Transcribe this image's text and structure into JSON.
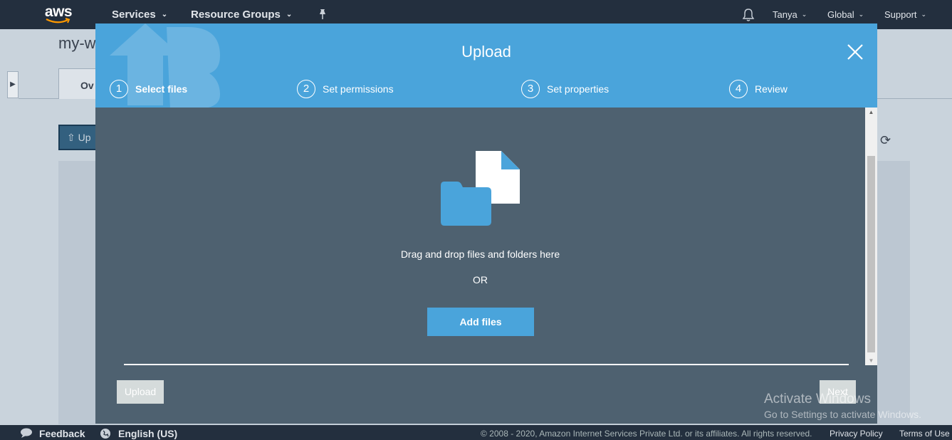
{
  "nav": {
    "logo": "aws",
    "services": "Services",
    "resource_groups": "Resource Groups",
    "pin_icon": "pin-icon",
    "bell_icon": "bell-icon",
    "user": "Tanya",
    "region": "Global",
    "support": "Support"
  },
  "background": {
    "bucket_title": "my-w",
    "tab_overview": "Ov",
    "upload_button": "Up"
  },
  "modal": {
    "title": "Upload",
    "steps": [
      {
        "number": "1",
        "label": "Select files",
        "active": true
      },
      {
        "number": "2",
        "label": "Set permissions",
        "active": false
      },
      {
        "number": "3",
        "label": "Set properties",
        "active": false
      },
      {
        "number": "4",
        "label": "Review",
        "active": false
      }
    ],
    "drop_text": "Drag and drop files and folders here",
    "or_text": "OR",
    "add_files": "Add files",
    "upload_button": "Upload",
    "next_button": "Next"
  },
  "watermark": {
    "line1": "Activate Windows",
    "line2": "Go to Settings to activate Windows."
  },
  "footer": {
    "feedback": "Feedback",
    "language": "English (US)",
    "copyright": "© 2008 - 2020, Amazon Internet Services Private Ltd. or its affiliates. All rights reserved.",
    "privacy": "Privacy Policy",
    "terms": "Terms of Use"
  },
  "colors": {
    "nav_bg": "#232f3e",
    "modal_header": "#4aa4db",
    "modal_body": "#4e6170",
    "accent": "#4aa4db",
    "disabled_button": "#d5dbdb"
  }
}
